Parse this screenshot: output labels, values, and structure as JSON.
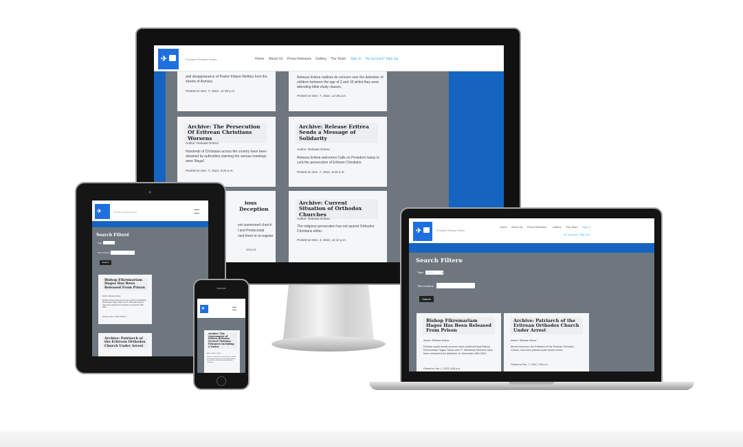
{
  "site": {
    "brand": "Proclaim! Release Eritrea",
    "nav": [
      "Home",
      "About Us",
      "Press Releases",
      "Gallery",
      "The Team"
    ],
    "sign_in": "Sign In",
    "signup_prompt": "No account? Sign Up",
    "logo_icon": "dove-logo-icon",
    "colors": {
      "accent": "#1565c0",
      "gray_bg": "#6b7580",
      "link": "#3bb3e8",
      "dark": "#222222"
    }
  },
  "search": {
    "heading": "Search Filters",
    "tags_label": "Tags:",
    "tags_value": "---------",
    "title_label": "Title contains:",
    "title_placeholder": "",
    "button": "Search"
  },
  "desktop": {
    "top_left": {
      "excerpt": "and disappearance of Pastor Kidane Weldou from the streets of Asmara.",
      "posted": "Posted on Dec. 7, 2022, 12:39 p.m."
    },
    "top_right": {
      "excerpt": "Release Eritrea outlines its concern over the detention of children between the age of 2 and 16 whilst they were attending bible study classes.",
      "posted": "Posted on Dec. 7, 2022, 12:35 p.m."
    },
    "mid_left": {
      "title": "Archive: The Persecution Of Eritrean Christians Worsens",
      "author": "Author: Release Eritrea",
      "excerpt": "Hundreds of Christians across the country have been detained by authorities claiming the various meetings were 'illegal'.",
      "posted": "Posted on Dec. 7, 2022, 6:26 a.m."
    },
    "mid_right": {
      "title": "Archive: Release Eritrea Sends a Message of Solidarity",
      "author": "Author: Release Eritrea",
      "excerpt": "Release Eritrea welcomes Calls on President Isaias to curb the persecution of Eritrean Christians.",
      "posted": "Posted on Dec. 7, 2022, 6:26 a.m."
    },
    "bot_left": {
      "title_a": "ious",
      "title_b": "Deception",
      "ex_a": "ent summoned church",
      "ex_b": "l and Pentecostal",
      "ex_c": "cted them to re-register",
      "posted": "14 p.m."
    },
    "bot_right": {
      "title": "Archive: Current Situation of Orthodox Churches",
      "author": "Author: Release Eritrea",
      "excerpt": "The religious persecution has not spared Orthodox Christians either.",
      "posted": "Posted on Dec. 3, 2022, 11:12 p.m."
    }
  },
  "laptop": {
    "card1": {
      "title": "Bishop Fikremariam Hagos Has Been Released From Prison",
      "author": "Author: Release Eritrea",
      "excerpt": "Eritrean social media sources have confirmed that Bishop Fikremariam Hagos Tsalim and Fr. Mihreteab Stefanos have been released from detention on December 28th 2022.",
      "posted": "Posted on Jan. 2, 2023, 6:58 p.m."
    },
    "card2": {
      "title": "Archive: Patriarch of the Eritrean Orthodox Church Under Arrest",
      "author": "Author: Release Eritrea",
      "excerpt": "Abune Antonios, the Patriarch of the Eritrean Orthodox Church, has been placed under house arrest.",
      "posted": "Posted on Dec. 7, 2022, 2:59 p.m."
    }
  },
  "tablet": {
    "card1": {
      "title": "Bishop Fikremariam Hagos Has Been Released From Prison",
      "author": "Author: Release Eritrea",
      "excerpt": "Eritrean social media sources have confirmed that Bishop Fikremariam Hagos Tsalim and Fr. Mihreteab Stefanos have been released from detention on December 28th 2022.",
      "posted": "Posted on Jan. 2, 2023, 6:58 p.m."
    },
    "card2": {
      "title": "Archive: Patriarch of the Eritrean Orthodox Church Under Arrest"
    }
  },
  "phone": {
    "card": {
      "title": "Archive: The Government of Eritrea Releases Several Christian Prisoners Including a Pastor",
      "author": "Author: Release Eritrea",
      "excerpt": "Sources in Eritrea have confirmed that a number of Christian prisoners have been released from church offices at the beginning of April with conditions."
    }
  }
}
